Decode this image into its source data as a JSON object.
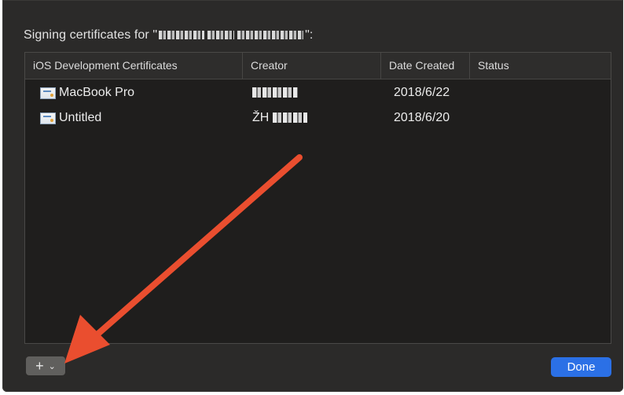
{
  "dialog": {
    "title_prefix": "Signing certificates for \"",
    "title_suffix": "\":",
    "title_redacted": true
  },
  "table": {
    "columns": [
      "iOS Development Certificates",
      "Creator",
      "Date Created",
      "Status"
    ],
    "rows": [
      {
        "name": "MacBook Pro",
        "creator_prefix": "",
        "creator_redacted": true,
        "date": "2018/6/22",
        "status": ""
      },
      {
        "name": "Untitled",
        "creator_prefix": "ŽH",
        "creator_redacted": true,
        "date": "2018/6/20",
        "status": ""
      }
    ]
  },
  "footer": {
    "add_label": "+",
    "add_menu_icon": "chevron-down-icon",
    "done_label": "Done"
  },
  "annotation": {
    "arrow_color": "#ea4e2f",
    "points_to": "add-button"
  },
  "colors": {
    "sheet_bg": "#2b2a29",
    "table_bg": "#1f1e1d",
    "accent": "#2b70e6"
  }
}
